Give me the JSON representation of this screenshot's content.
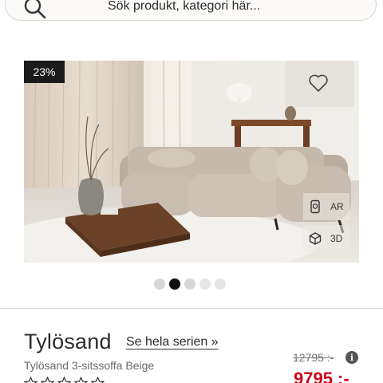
{
  "search": {
    "placeholder": "Sök produkt, kategori här..."
  },
  "breadcrumb": {
    "items": [
      "",
      "",
      "",
      ""
    ]
  },
  "product": {
    "discount_badge": "23%",
    "image_count": 5,
    "active_image": 2,
    "name": "Tylösand",
    "series_link": "Se hela serien »",
    "subtitle": "Tylösand 3-sitssoffa Beige",
    "old_price": "12795 :-",
    "new_price": "9795 :-",
    "rating_stars": 5
  },
  "view_buttons": {
    "ar_label": "AR",
    "three_d_label": "3D"
  },
  "icons": {
    "search": "search-icon",
    "wishlist": "heart-icon",
    "ar": "ar-view-icon",
    "three_d": "cube-3d-icon",
    "info": "info-icon",
    "rating": "star-icon"
  },
  "colors": {
    "sale_price": "#d0021b",
    "badge_bg": "#1a1a1a",
    "active_dot": "#111111",
    "inactive_dot": "#d6d6d6"
  }
}
